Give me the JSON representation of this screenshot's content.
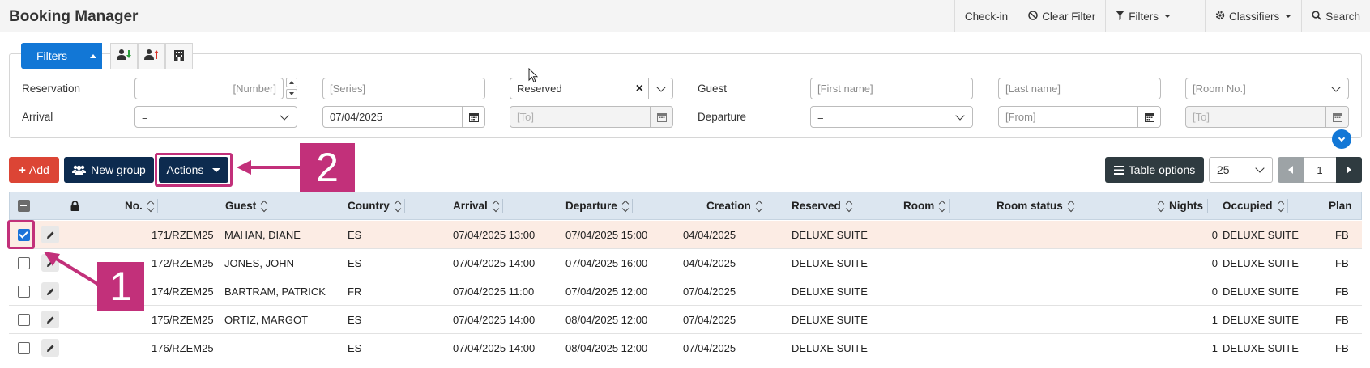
{
  "app": {
    "title": "Booking Manager"
  },
  "topnav": {
    "checkin": "Check-in",
    "clear_filter": "Clear Filter",
    "filters": "Filters",
    "classifiers": "Classifiers",
    "search": "Search"
  },
  "filter_panel": {
    "filters_button": "Filters",
    "labels": {
      "reservation": "Reservation",
      "guest": "Guest",
      "arrival": "Arrival",
      "departure": "Departure"
    },
    "reservation_number": {
      "placeholder": "[Number]"
    },
    "series": {
      "placeholder": "[Series]"
    },
    "status": {
      "value": "Reserved"
    },
    "first_name": {
      "placeholder": "[First name]"
    },
    "last_name": {
      "placeholder": "[Last name]"
    },
    "room_no": {
      "placeholder": "[Room No.]"
    },
    "arrival_op": {
      "value": "="
    },
    "arrival_from": {
      "value": "07/04/2025"
    },
    "arrival_to": {
      "placeholder": "[To]"
    },
    "departure_op": {
      "value": "="
    },
    "departure_from": {
      "placeholder": "[From]"
    },
    "departure_to": {
      "placeholder": "[To]"
    }
  },
  "actions_bar": {
    "add": "Add",
    "new_group": "New group",
    "actions": "Actions",
    "table_options": "Table options",
    "page_size": "25",
    "page": "1"
  },
  "table": {
    "columns": [
      "No.",
      "Guest",
      "Country",
      "Arrival",
      "Departure",
      "Creation",
      "Reserved",
      "Room",
      "Room status",
      "Nights",
      "Occupied",
      "Plan"
    ],
    "rows": [
      {
        "selected": true,
        "no": "171/RZEM25",
        "guest": "MAHAN, DIANE",
        "country": "ES",
        "arrival": "07/04/2025 13:00",
        "departure": "07/04/2025 15:00",
        "creation": "04/04/2025",
        "reserved": "DELUXE SUITE",
        "room": "",
        "room_status": "",
        "nights": "0",
        "occupied": "DELUXE SUITE",
        "plan": "FB"
      },
      {
        "selected": false,
        "no": "172/RZEM25",
        "guest": "JONES, JOHN",
        "country": "ES",
        "arrival": "07/04/2025 14:00",
        "departure": "07/04/2025 16:00",
        "creation": "04/04/2025",
        "reserved": "DELUXE SUITE",
        "room": "",
        "room_status": "",
        "nights": "0",
        "occupied": "DELUXE SUITE",
        "plan": "FB"
      },
      {
        "selected": false,
        "no": "174/RZEM25",
        "guest": "BARTRAM, PATRICK",
        "country": "FR",
        "arrival": "07/04/2025 11:00",
        "departure": "07/04/2025 12:00",
        "creation": "07/04/2025",
        "reserved": "DELUXE SUITE",
        "room": "",
        "room_status": "",
        "nights": "0",
        "occupied": "DELUXE SUITE",
        "plan": "FB"
      },
      {
        "selected": false,
        "no": "175/RZEM25",
        "guest": "ORTIZ, MARGOT",
        "country": "ES",
        "arrival": "07/04/2025 14:00",
        "departure": "08/04/2025 12:00",
        "creation": "07/04/2025",
        "reserved": "DELUXE SUITE",
        "room": "",
        "room_status": "",
        "nights": "1",
        "occupied": "DELUXE SUITE",
        "plan": "FB"
      },
      {
        "selected": false,
        "no": "176/RZEM25",
        "guest": "",
        "country": "ES",
        "arrival": "07/04/2025 14:00",
        "departure": "08/04/2025 12:00",
        "creation": "07/04/2025",
        "reserved": "DELUXE SUITE",
        "room": "",
        "room_status": "",
        "nights": "1",
        "occupied": "DELUXE SUITE",
        "plan": "FB"
      }
    ]
  },
  "annotations": {
    "one": "1",
    "two": "2"
  },
  "colors": {
    "primary": "#1277d6",
    "danger": "#dc4535",
    "navy": "#0d2b4f",
    "annotation": "#c2307a",
    "selected_row": "#fcece4"
  }
}
